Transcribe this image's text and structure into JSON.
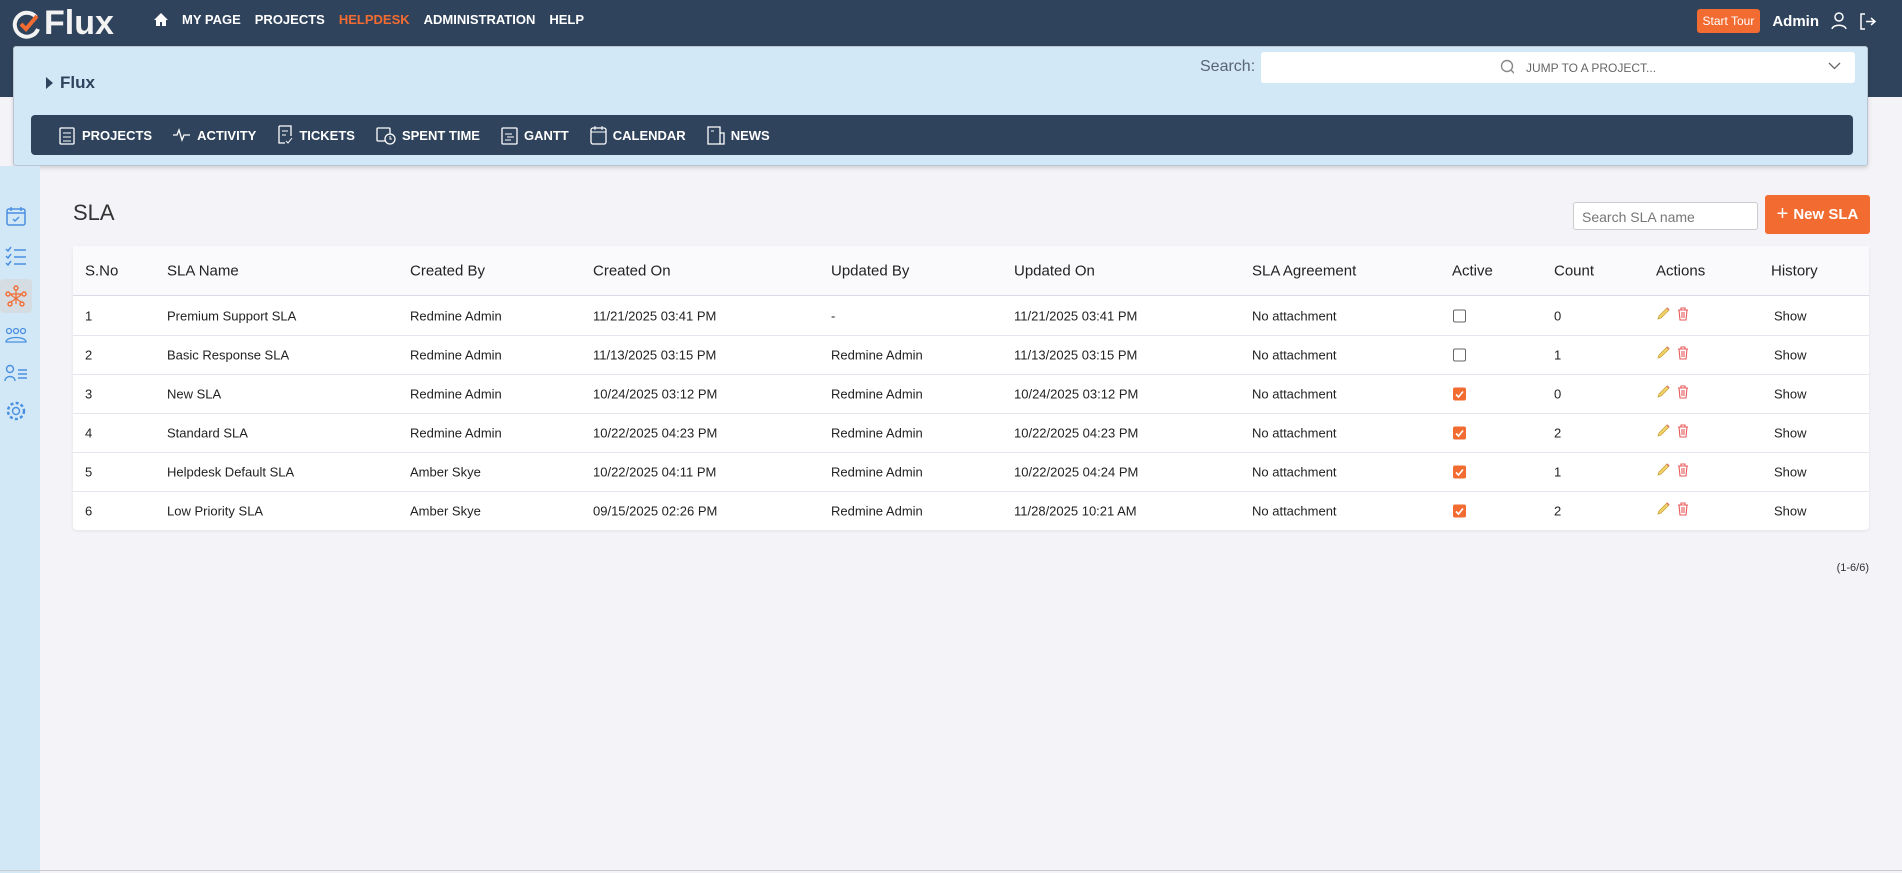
{
  "app": {
    "logo": "Flux"
  },
  "topnav": {
    "items": [
      {
        "label": "MY PAGE"
      },
      {
        "label": "PROJECTS"
      },
      {
        "label": "HELPDESK",
        "active": true
      },
      {
        "label": "ADMINISTRATION"
      },
      {
        "label": "HELP"
      }
    ],
    "start_tour": "Start Tour",
    "user": "Admin"
  },
  "panel": {
    "breadcrumb": "Flux",
    "search_label": "Search:",
    "search_value": "",
    "jump_placeholder": "JUMP TO A PROJECT..."
  },
  "projnav": [
    "PROJECTS",
    "ACTIVITY",
    "TICKETS",
    "SPENT TIME",
    "GANTT",
    "CALENDAR",
    "NEWS"
  ],
  "page": {
    "title": "SLA",
    "search_placeholder": "Search SLA name",
    "new_button": "New SLA",
    "pagination": "(1-6/6)"
  },
  "table": {
    "headers": [
      "S.No",
      "SLA Name",
      "Created By",
      "Created On",
      "Updated By",
      "Updated On",
      "SLA Agreement",
      "Active",
      "Count",
      "Actions",
      "History"
    ],
    "rows": [
      {
        "sno": "1",
        "name": "Premium Support SLA",
        "created_by": "Redmine Admin",
        "created_on": "11/21/2025 03:41 PM",
        "updated_by": "-",
        "updated_on": "11/21/2025 03:41 PM",
        "agreement": "No attachment",
        "active": false,
        "count": "0",
        "history": "Show"
      },
      {
        "sno": "2",
        "name": "Basic Response SLA",
        "created_by": "Redmine Admin",
        "created_on": "11/13/2025 03:15 PM",
        "updated_by": "Redmine Admin",
        "updated_on": "11/13/2025 03:15 PM",
        "agreement": "No attachment",
        "active": false,
        "count": "1",
        "history": "Show"
      },
      {
        "sno": "3",
        "name": "New SLA",
        "created_by": "Redmine Admin",
        "created_on": "10/24/2025 03:12 PM",
        "updated_by": "Redmine Admin",
        "updated_on": "10/24/2025 03:12 PM",
        "agreement": "No attachment",
        "active": true,
        "count": "0",
        "history": "Show"
      },
      {
        "sno": "4",
        "name": "Standard SLA",
        "created_by": "Redmine Admin",
        "created_on": "10/22/2025 04:23 PM",
        "updated_by": "Redmine Admin",
        "updated_on": "10/22/2025 04:23 PM",
        "agreement": "No attachment",
        "active": true,
        "count": "2",
        "history": "Show"
      },
      {
        "sno": "5",
        "name": "Helpdesk Default SLA",
        "created_by": "Amber Skye",
        "created_on": "10/22/2025 04:11 PM",
        "updated_by": "Redmine Admin",
        "updated_on": "10/22/2025 04:24 PM",
        "agreement": "No attachment",
        "active": true,
        "count": "1",
        "history": "Show"
      },
      {
        "sno": "6",
        "name": "Low Priority SLA",
        "created_by": "Amber Skye",
        "created_on": "09/15/2025 02:26 PM",
        "updated_by": "Redmine Admin",
        "updated_on": "11/28/2025 10:21 AM",
        "agreement": "No attachment",
        "active": true,
        "count": "2",
        "history": "Show"
      }
    ]
  },
  "colors": {
    "accent": "#f26b30",
    "navy": "#2f435c",
    "panel": "#d3e8f6"
  }
}
